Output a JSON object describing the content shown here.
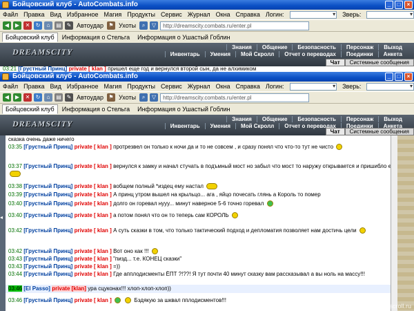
{
  "window": {
    "title": "Бойцовский клуб - AutoCombats.info"
  },
  "menu": {
    "items": [
      "Файл",
      "Правка",
      "Вид",
      "Избранное",
      "Магия",
      "Продукты",
      "Сервис",
      "Журнал",
      "Окна",
      "Справка"
    ],
    "login_label": "Логин:",
    "animal_label": "Зверь:"
  },
  "toolbar": {
    "autodar": "Автоудар",
    "uhoty": "Ухоты",
    "url": "http://dreamscity.combats.ru/enter.pl"
  },
  "tabs": [
    "Бойцовский клуб",
    "Информация о Стельга",
    "Информация о Ушастый Гоблин"
  ],
  "game": {
    "logo": "DREAMSCITY",
    "nav_top": [
      "Знания",
      "Общение",
      "Безопасность",
      "Персонаж",
      "Выход"
    ],
    "nav_bottom": [
      "Инвентарь",
      "Умения",
      "Мой Скролл",
      "Отчет о переводах",
      "Поединки",
      "Анкета"
    ],
    "chat_tab": "Чат",
    "system_tab": "Системные сообщения"
  },
  "back_window": {
    "time": "03:21",
    "name": "[Грустный Принц]",
    "private": "private [ klan ]",
    "text": "пришел еще год и вернулся второй сын, да не алхимиком"
  },
  "chat": [
    {
      "time": "",
      "name": "",
      "private": "",
      "text": "сказка очень даже ничего"
    },
    {
      "time": "03:35",
      "name": "[Грустный Принц]",
      "private": "private [ klan ]",
      "text": "протрезвел он только к ночи да и то не совсем , и сразу понял что что-то тут не чисто"
    },
    {
      "time": "03:37",
      "name": "[Грустный Принц]",
      "private": "private [ klan ]",
      "text": "вернулся к замку и начал стучать в подъмный мост     но забыл что мост то наружу открывается и пришибло его"
    },
    {
      "time": "03:38",
      "name": "[Грустный Принц]",
      "private": "private [ klan ]",
      "text": "вобщем полный *издец ему настал"
    },
    {
      "time": "03:39",
      "name": "[Грустный Принц]",
      "private": "private [ klan ]",
      "text": "А принц утром вышел на крыльцо... ага , яйцо почесать   глянь а Король   то помер"
    },
    {
      "time": "03:40",
      "name": "[Грустный Принц]",
      "private": "private [ klan ]",
      "text": "долго он горевал   нууу... минут наверное 5-6 точно горевал"
    },
    {
      "time": "03:40",
      "name": "[Грустный Принц]",
      "private": "private [ klan ]",
      "text": "а потом понял   что он то теперь сам КОРОЛЬ"
    },
    {
      "time": "03:42",
      "name": "[Грустный Принц]",
      "private": "private [ klan ]",
      "text": "А суть сказки в том, что только тактический подход     и депломатия     позволяет нам достичь цели"
    },
    {
      "time": "03:42",
      "name": "[Грустный Принц]",
      "private": "private [ klan ]",
      "text": "Вот оно как !!!"
    },
    {
      "time": "03:43",
      "name": "[Грустный Принц]",
      "private": "private [ klan ]",
      "text": "\"пизд... т.е. КОНЕЦ сказки\""
    },
    {
      "time": "03:43",
      "name": "[Грустный Принц]",
      "private": "private [ klan ]",
      "text": "=))"
    },
    {
      "time": "03:44",
      "name": "[Грустный Принц]",
      "private": "private [ klan ]",
      "text": "Где апплодисменты ЁПТ ?!??! Я тут почти 40 минут сказку вам рассказывал а вы ноль на массу!!!"
    },
    {
      "time": "03:46",
      "name": "[El Passo]",
      "private": "private [klan]",
      "text": "ура сцуконах!!! хлоп-хлоп-хлоп))",
      "highlight": true
    },
    {
      "time": "03:46",
      "name": "[Грустный Принц]",
      "private": "private [ klan ]",
      "text": "Бздякую за шквал пплодисментов!!!"
    }
  ],
  "watermark": "photo.scroll.ru",
  "colors": {
    "time": "#007000",
    "name": "#0040a0",
    "private": "#e00000",
    "titlebar": "#0a4fc4"
  }
}
